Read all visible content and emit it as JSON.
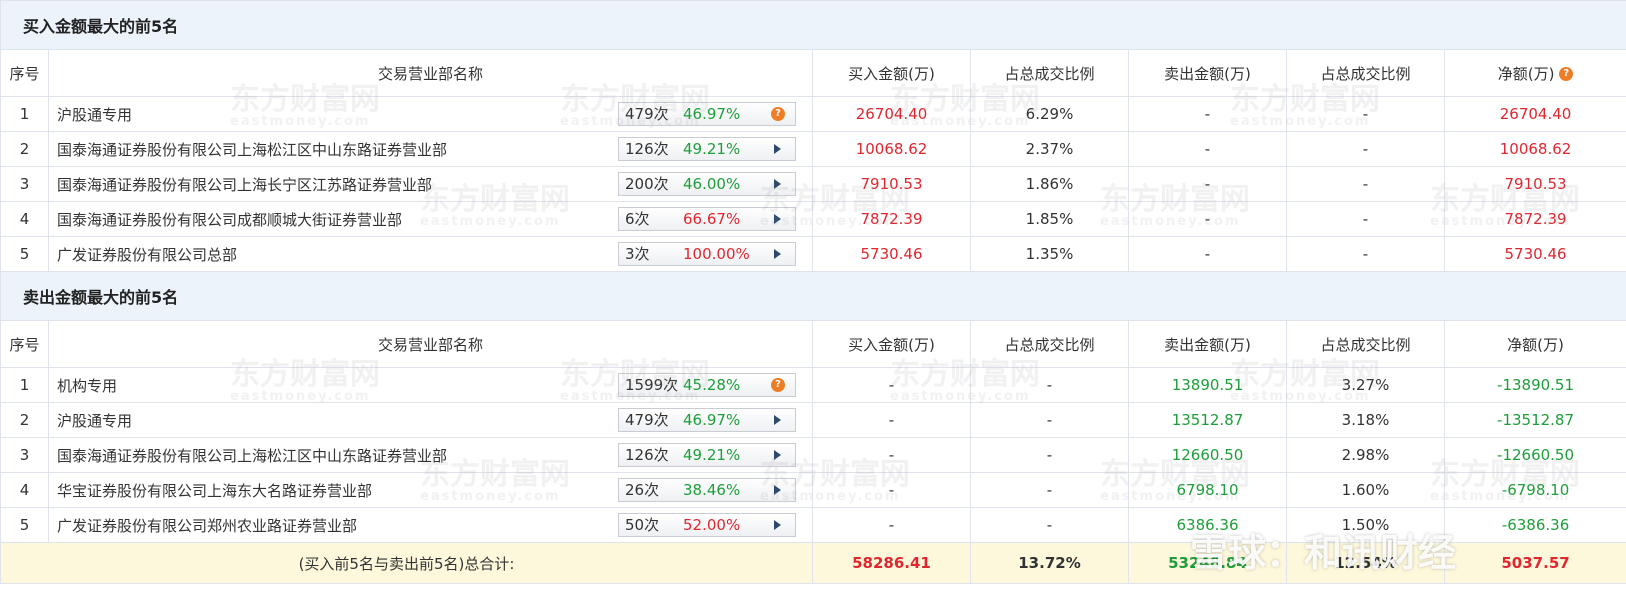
{
  "buy_section": {
    "title": "买入金额最大的前5名",
    "headers": [
      "序号",
      "交易营业部名称",
      "买入金额(万)",
      "占总成交比例",
      "卖出金额(万)",
      "占总成交比例",
      "净额(万)"
    ],
    "rows": [
      {
        "rank": "1",
        "name": "沪股通专用",
        "count": "479次",
        "pct": "46.97%",
        "pct_color": "green",
        "icon": "question-icon",
        "buy": "26704.40",
        "buy_ratio": "6.29%",
        "sell": "-",
        "sell_ratio": "-",
        "net": "26704.40"
      },
      {
        "rank": "2",
        "name": "国泰海通证券股份有限公司上海松江区中山东路证券营业部",
        "count": "126次",
        "pct": "49.21%",
        "pct_color": "green",
        "icon": "arrow-right-icon",
        "buy": "10068.62",
        "buy_ratio": "2.37%",
        "sell": "-",
        "sell_ratio": "-",
        "net": "10068.62"
      },
      {
        "rank": "3",
        "name": "国泰海通证券股份有限公司上海长宁区江苏路证券营业部",
        "count": "200次",
        "pct": "46.00%",
        "pct_color": "green",
        "icon": "arrow-right-icon",
        "buy": "7910.53",
        "buy_ratio": "1.86%",
        "sell": "-",
        "sell_ratio": "-",
        "net": "7910.53"
      },
      {
        "rank": "4",
        "name": "国泰海通证券股份有限公司成都顺城大街证券营业部",
        "count": "6次",
        "pct": "66.67%",
        "pct_color": "red",
        "icon": "arrow-right-icon",
        "buy": "7872.39",
        "buy_ratio": "1.85%",
        "sell": "-",
        "sell_ratio": "-",
        "net": "7872.39"
      },
      {
        "rank": "5",
        "name": "广发证券股份有限公司总部",
        "count": "3次",
        "pct": "100.00%",
        "pct_color": "red",
        "icon": "arrow-right-icon",
        "buy": "5730.46",
        "buy_ratio": "1.35%",
        "sell": "-",
        "sell_ratio": "-",
        "net": "5730.46"
      }
    ]
  },
  "sell_section": {
    "title": "卖出金额最大的前5名",
    "headers": [
      "序号",
      "交易营业部名称",
      "买入金额(万)",
      "占总成交比例",
      "卖出金额(万)",
      "占总成交比例",
      "净额(万)"
    ],
    "rows": [
      {
        "rank": "1",
        "name": "机构专用",
        "count": "1599次",
        "pct": "45.28%",
        "pct_color": "green",
        "icon": "question-icon",
        "buy": "-",
        "buy_ratio": "-",
        "sell": "13890.51",
        "sell_ratio": "3.27%",
        "net": "-13890.51"
      },
      {
        "rank": "2",
        "name": "沪股通专用",
        "count": "479次",
        "pct": "46.97%",
        "pct_color": "green",
        "icon": "arrow-right-icon",
        "buy": "-",
        "buy_ratio": "-",
        "sell": "13512.87",
        "sell_ratio": "3.18%",
        "net": "-13512.87"
      },
      {
        "rank": "3",
        "name": "国泰海通证券股份有限公司上海松江区中山东路证券营业部",
        "count": "126次",
        "pct": "49.21%",
        "pct_color": "green",
        "icon": "arrow-right-icon",
        "buy": "-",
        "buy_ratio": "-",
        "sell": "12660.50",
        "sell_ratio": "2.98%",
        "net": "-12660.50"
      },
      {
        "rank": "4",
        "name": "华宝证券股份有限公司上海东大名路证券营业部",
        "count": "26次",
        "pct": "38.46%",
        "pct_color": "green",
        "icon": "arrow-right-icon",
        "buy": "-",
        "buy_ratio": "-",
        "sell": "6798.10",
        "sell_ratio": "1.60%",
        "net": "-6798.10"
      },
      {
        "rank": "5",
        "name": "广发证券股份有限公司郑州农业路证券营业部",
        "count": "50次",
        "pct": "52.00%",
        "pct_color": "red",
        "icon": "arrow-right-icon",
        "buy": "-",
        "buy_ratio": "-",
        "sell": "6386.36",
        "sell_ratio": "1.50%",
        "net": "-6386.36"
      }
    ]
  },
  "totals": {
    "label": "(买入前5名与卖出前5名)总合计:",
    "buy": "58286.41",
    "buy_ratio": "13.72%",
    "sell": "53248.84",
    "sell_ratio": "12.54%",
    "net": "5037.57"
  },
  "net_header_icon": "question-icon",
  "watermark": {
    "brand": "东方财富网",
    "domain": "eastmoney.com"
  },
  "overlay_watermark": "雪球：和讯财经",
  "colors": {
    "section_bg": "#ecf3fb",
    "total_bg": "#fdf8dc",
    "red": "#e0262f",
    "green": "#1e9e3a",
    "border": "#dfe4ec",
    "help_icon": "#ee7d26"
  }
}
